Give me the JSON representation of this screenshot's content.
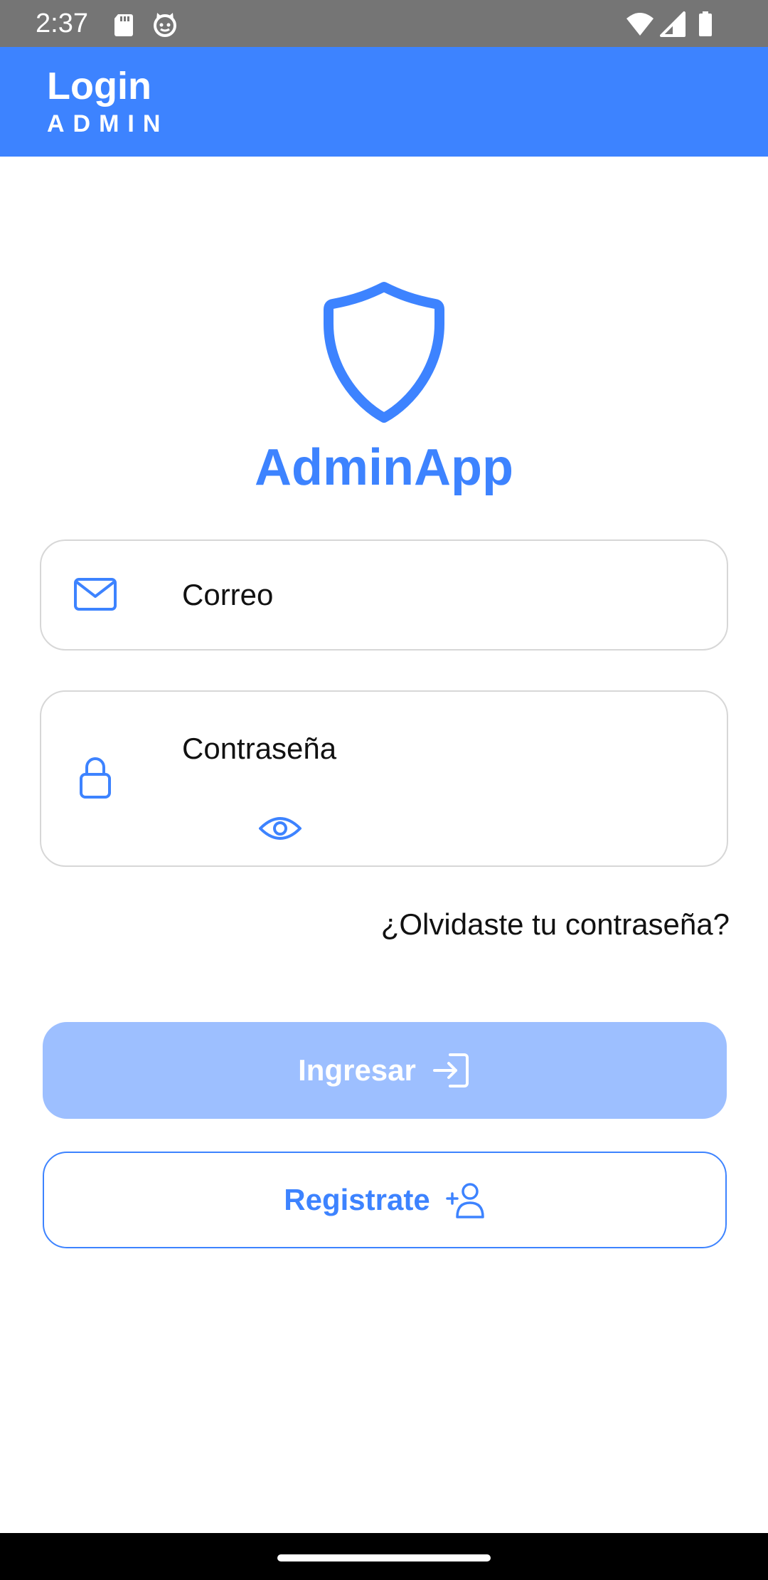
{
  "status_bar": {
    "time": "2:37",
    "icons": [
      "sd-card-icon",
      "cat-face-icon",
      "wifi-icon",
      "signal-icon",
      "battery-icon"
    ]
  },
  "app_bar": {
    "title": "Login",
    "subtitle": "ADMIN"
  },
  "brand": {
    "logo_icon": "shield-icon",
    "name": "AdminApp"
  },
  "form": {
    "email": {
      "label": "Correo",
      "icon": "mail-icon"
    },
    "password": {
      "label": "Contraseña",
      "icon": "lock-icon",
      "toggle_icon": "eye-icon"
    },
    "forgot_link": "¿Olvidaste tu contraseña?"
  },
  "buttons": {
    "login_label": "Ingresar",
    "login_icon": "sign-in-icon",
    "register_label": "Registrate",
    "register_icon": "add-user-icon"
  },
  "colors": {
    "primary": "#3d83ff",
    "primary_disabled": "#9dbfff",
    "status_bar": "#757575",
    "nav_bar": "#000000",
    "field_border": "#d7d7d7"
  }
}
